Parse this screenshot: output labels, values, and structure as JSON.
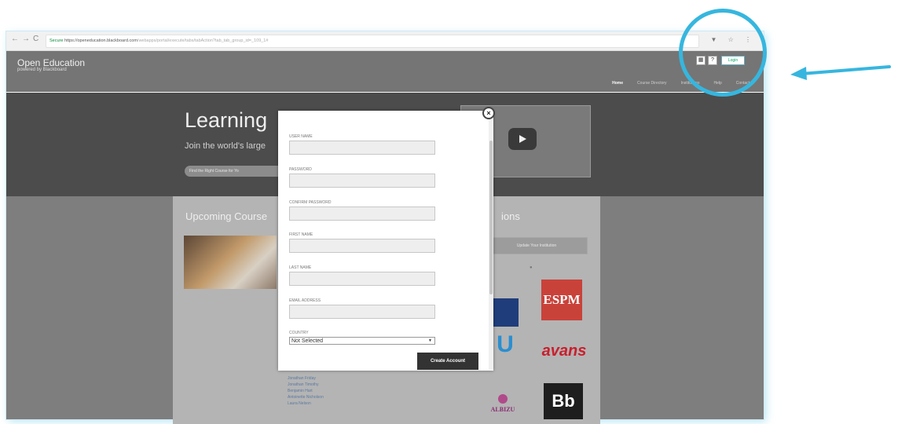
{
  "browser": {
    "nav_back": "←",
    "nav_forward": "→",
    "nav_reload": "C",
    "secure_label": "Secure",
    "url_host": "https://openeducation.blackboard.com",
    "url_path": "/webapps/portal/execute/tabs/tabAction?tab_tab_group_id=_109_1#",
    "icons": "▼ ☆ ⋮"
  },
  "site": {
    "brand_title": "Open Education",
    "brand_sub": "powered by Blackboard",
    "login_label": "Login",
    "nav": [
      "Home",
      "Course Directory",
      "Institutions",
      "Help",
      "Contact"
    ]
  },
  "hero": {
    "title": "Learning",
    "subtitle": "Join the world's large",
    "pill": "Find the Right Course for Yo"
  },
  "panel": {
    "upcoming_title": "Upcoming Course",
    "right_title": "ions",
    "inst_button": "Update Your Institution",
    "logo_espm": "ESPM",
    "logo_u": "U",
    "logo_avans": "avans",
    "logo_albizu": "ALBIZU",
    "logo_bb": "Bb",
    "links": [
      "Jonathan Friday",
      "Jonathan Timothy",
      "Benjamin Hart",
      "Antoinette Nicholson",
      "Laura Nelson"
    ]
  },
  "modal": {
    "close": "×",
    "fields": [
      {
        "label": "USER NAME"
      },
      {
        "label": "PASSWORD"
      },
      {
        "label": "CONFIRM PASSWORD"
      },
      {
        "label": "FIRST NAME"
      },
      {
        "label": "LAST NAME"
      },
      {
        "label": "EMAIL ADDRESS"
      }
    ],
    "country_label": "COUNTRY",
    "country_value": "Not Selected",
    "create_label": "Create Account"
  },
  "colors": {
    "annotation": "#36b6de",
    "hero_bg": "#4c4c4c",
    "button_dark": "#333333"
  }
}
